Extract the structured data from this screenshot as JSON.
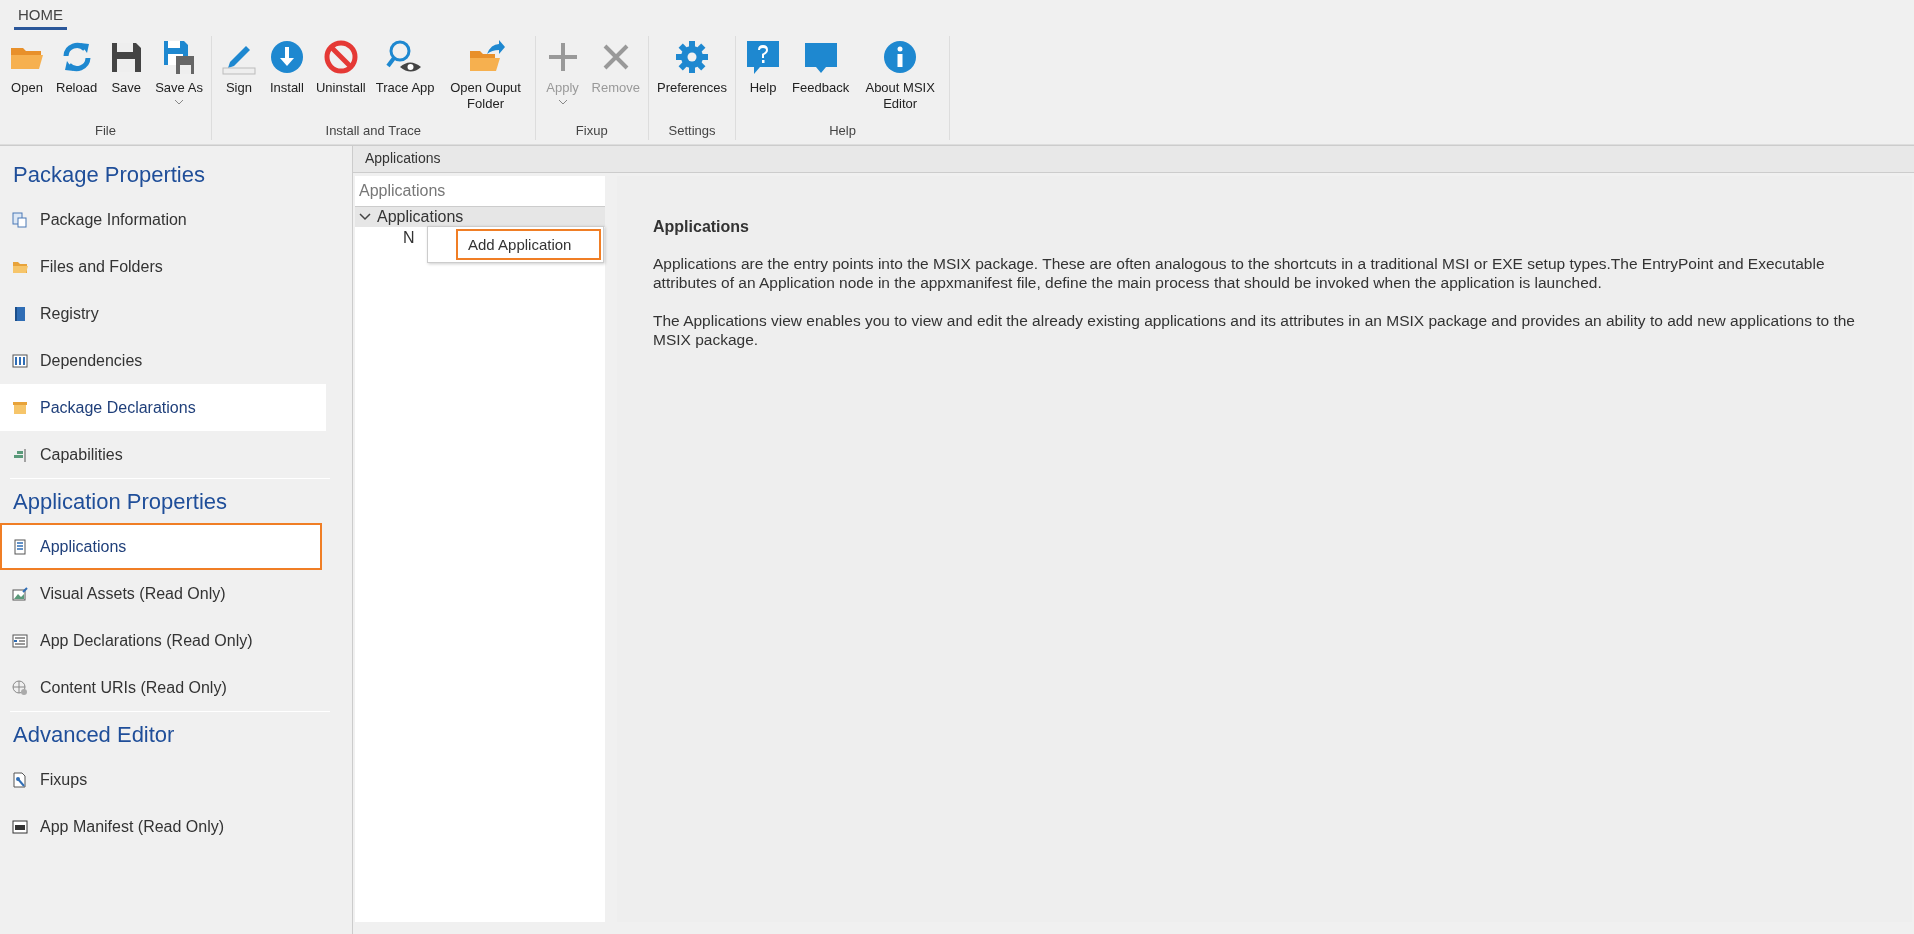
{
  "ribbon_tabs": [
    {
      "label": "HOME",
      "selected": true
    }
  ],
  "ribbon_groups": [
    {
      "label": "File",
      "buttons": [
        {
          "label": "Open",
          "disabled": false,
          "dropdown": false
        },
        {
          "label": "Reload",
          "disabled": false,
          "dropdown": false
        },
        {
          "label": "Save",
          "disabled": false,
          "dropdown": false
        },
        {
          "label": "Save As",
          "disabled": false,
          "dropdown": true
        }
      ]
    },
    {
      "label": "Install and Trace",
      "buttons": [
        {
          "label": "Sign",
          "disabled": false,
          "dropdown": false
        },
        {
          "label": "Install",
          "disabled": false,
          "dropdown": false
        },
        {
          "label": "Uninstall",
          "disabled": false,
          "dropdown": false
        },
        {
          "label": "Trace App",
          "disabled": false,
          "dropdown": false
        },
        {
          "label": "Open Ouput Folder",
          "disabled": false,
          "dropdown": false
        }
      ]
    },
    {
      "label": "Fixup",
      "buttons": [
        {
          "label": "Apply",
          "disabled": true,
          "dropdown": true
        },
        {
          "label": "Remove",
          "disabled": true,
          "dropdown": false
        }
      ]
    },
    {
      "label": "Settings",
      "buttons": [
        {
          "label": "Preferences",
          "disabled": false,
          "dropdown": false
        }
      ]
    },
    {
      "label": "Help",
      "buttons": [
        {
          "label": "Help",
          "disabled": false,
          "dropdown": false
        },
        {
          "label": "Feedback",
          "disabled": false,
          "dropdown": false
        },
        {
          "label": "About MSIX Editor",
          "disabled": false,
          "dropdown": false
        }
      ]
    }
  ],
  "sidebar": {
    "sections": [
      {
        "title": "Package Properties",
        "items": [
          {
            "label": "Package Information",
            "selected": false,
            "highlighted": false
          },
          {
            "label": "Files and Folders",
            "selected": false,
            "highlighted": false
          },
          {
            "label": "Registry",
            "selected": false,
            "highlighted": false
          },
          {
            "label": "Dependencies",
            "selected": false,
            "highlighted": false
          },
          {
            "label": "Package Declarations",
            "selected": false,
            "highlighted": true
          },
          {
            "label": "Capabilities",
            "selected": false,
            "highlighted": false
          }
        ]
      },
      {
        "title": "Application Properties",
        "items": [
          {
            "label": "Applications",
            "selected": true,
            "highlighted": false
          },
          {
            "label": "Visual Assets (Read Only)",
            "selected": false,
            "highlighted": false
          },
          {
            "label": "App Declarations (Read Only)",
            "selected": false,
            "highlighted": false
          },
          {
            "label": "Content URIs (Read Only)",
            "selected": false,
            "highlighted": false
          }
        ]
      },
      {
        "title": "Advanced Editor",
        "items": [
          {
            "label": "Fixups",
            "selected": false,
            "highlighted": false
          },
          {
            "label": "App Manifest (Read Only)",
            "selected": false,
            "highlighted": false
          }
        ]
      }
    ]
  },
  "page_header": "Applications",
  "tree": {
    "title": "Applications",
    "nodes": [
      {
        "label": "Applications",
        "expanded": true,
        "children": [
          {
            "label": "N"
          }
        ]
      }
    ]
  },
  "context_menu": {
    "items": [
      {
        "label": "Add Application",
        "selected": true
      }
    ]
  },
  "info": {
    "title": "Applications",
    "paragraphs": [
      "Applications are the entry points into the MSIX package. These are often analogous to the shortcuts in a traditional MSI or EXE setup types.The EntryPoint and Executable attributes of an Application node in the appxmanifest file, define the main process that should be invoked when the application is launched.",
      "The Applications view enables you to view and edit the already existing applications and its attributes in an MSIX package and provides an ability to add new applications to the MSIX package."
    ]
  }
}
